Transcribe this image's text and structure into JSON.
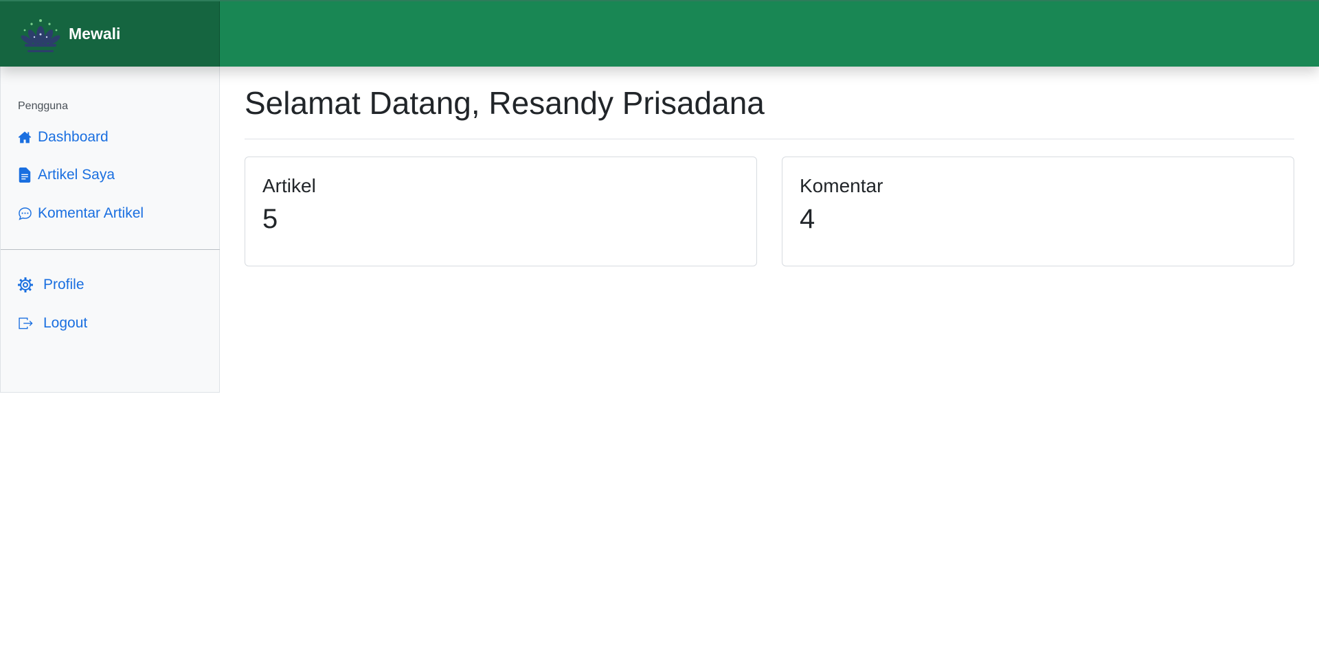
{
  "brand": {
    "name": "Mewali",
    "logo_icon": "lotus-logo-icon"
  },
  "colors": {
    "navbar": "#198754",
    "brand_bg": "#156540",
    "link": "#1a6fe0",
    "sidebar_bg": "#f8f9fa"
  },
  "sidebar": {
    "section_title": "Pengguna",
    "items": [
      {
        "label": "Dashboard",
        "icon": "house-icon"
      },
      {
        "label": "Artikel Saya",
        "icon": "document-icon"
      },
      {
        "label": "Komentar Artikel",
        "icon": "chat-dots-icon"
      }
    ],
    "bottom_items": [
      {
        "label": "Profile",
        "icon": "gear-icon"
      },
      {
        "label": "Logout",
        "icon": "logout-icon"
      }
    ]
  },
  "main": {
    "title": "Selamat Datang, Resandy Prisadana",
    "cards": [
      {
        "title": "Artikel",
        "value": "5"
      },
      {
        "title": "Komentar",
        "value": "4"
      }
    ]
  }
}
